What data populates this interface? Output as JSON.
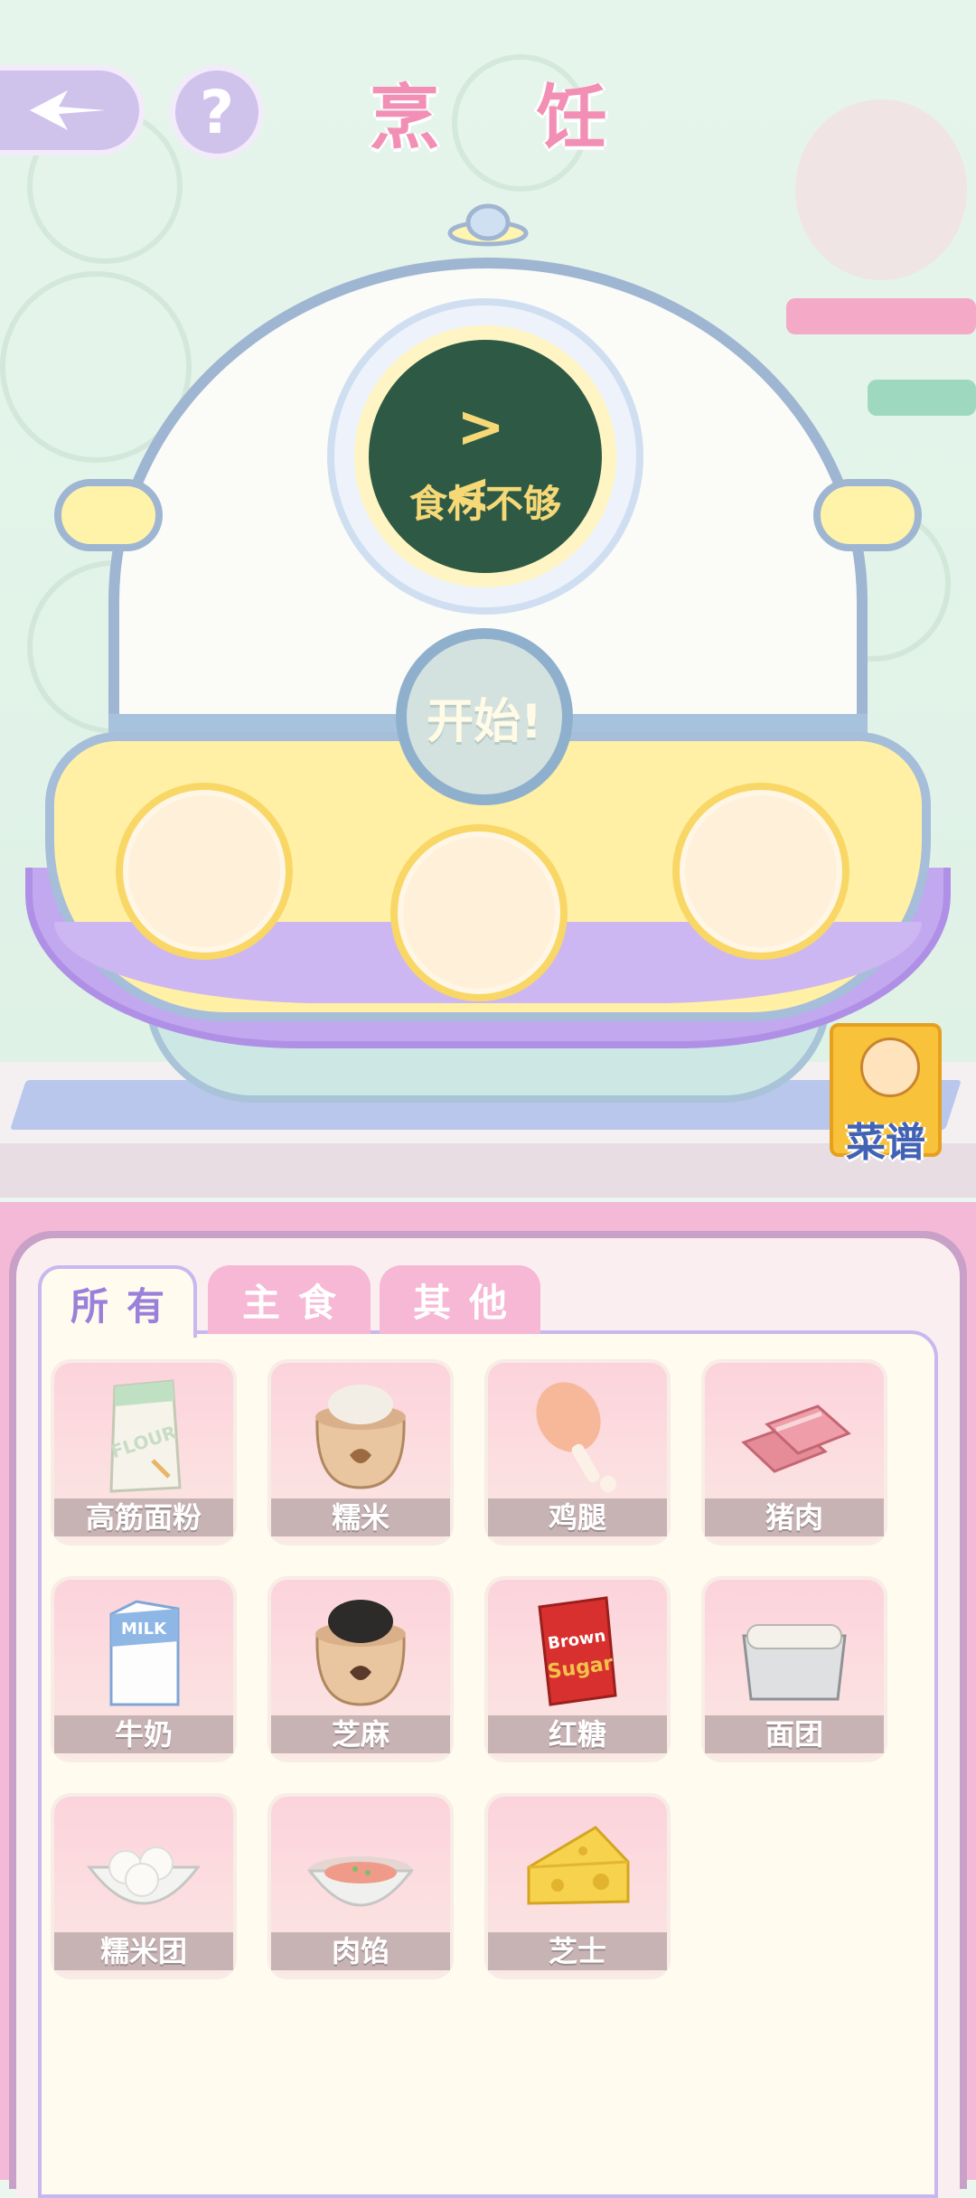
{
  "header": {
    "title": "烹 饪",
    "help_glyph": "?"
  },
  "machine": {
    "screen_face": "> <",
    "screen_status": "食材不够",
    "start_label": "开始!",
    "slots": 3
  },
  "recipe": {
    "label": "菜谱"
  },
  "tabs": [
    {
      "label": "所有",
      "active": true
    },
    {
      "label": "主食",
      "active": false
    },
    {
      "label": "其他",
      "active": false
    }
  ],
  "items": [
    {
      "label": "高筋面粉",
      "icon": "flour-icon"
    },
    {
      "label": "糯米",
      "icon": "rice-sack-icon"
    },
    {
      "label": "鸡腿",
      "icon": "chicken-leg-icon"
    },
    {
      "label": "猪肉",
      "icon": "pork-icon"
    },
    {
      "label": "牛奶",
      "icon": "milk-carton-icon"
    },
    {
      "label": "芝麻",
      "icon": "sesame-sack-icon"
    },
    {
      "label": "红糖",
      "icon": "brown-sugar-icon"
    },
    {
      "label": "面团",
      "icon": "dough-icon"
    },
    {
      "label": "糯米团",
      "icon": "rice-balls-icon"
    },
    {
      "label": "肉馅",
      "icon": "meat-filling-icon"
    },
    {
      "label": "芝士",
      "icon": "cheese-icon"
    }
  ],
  "icon_text": {
    "flour": "FLOUR",
    "milk": "MILK",
    "sugar_top": "Brown",
    "sugar_bottom": "Sugar"
  },
  "colors": {
    "title": "#f28fb4",
    "tab_active": "#9a80da",
    "tab_inactive": "#f6b8d4",
    "screen": "#2e5a45",
    "screen_text": "#f6d877"
  }
}
